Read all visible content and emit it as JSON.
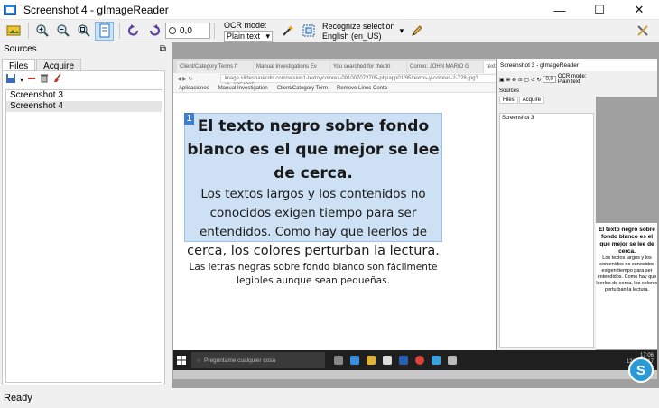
{
  "window": {
    "title": "Screenshot 4 - gImageReader",
    "minimize": "—",
    "maximize": "☐",
    "close": "✕"
  },
  "toolbar": {
    "resolution_value": "0,0",
    "ocr_mode_label": "OCR mode:",
    "ocr_mode_value": "Plain text",
    "recognize_label": "Recognize selection",
    "recognize_lang": "English (en_US)"
  },
  "sources": {
    "title": "Sources",
    "tabs": [
      "Files",
      "Acquire"
    ],
    "files": [
      "Screenshot 3",
      "Screenshot 4"
    ],
    "selected_index": 1
  },
  "browser": {
    "tabs": [
      "Client/Category Terms fr",
      "Manual Investigations Ev",
      "You searched for theutri",
      "Correo: JOHN MARIO G",
      "texto"
    ],
    "address": "image.slidesharecdn.com/sesion1-textoycolores-091007072705-phpapp01/95/textos-y-colores-2-728.jpg?cb=1254905",
    "bookmarks": [
      "Aplicaciones",
      "Manual Investigation",
      "Client/Category Term",
      "Remove Lines Conta"
    ]
  },
  "document": {
    "selection_number": "1",
    "heading": "El texto negro sobre fondo blanco es el que mejor se lee de cerca.",
    "para1": "Los textos largos y los contenidos no conocidos exigen tiempo para ser entendidos. Como hay que leerlos de",
    "para2": "cerca, los colores perturban la lectura.",
    "para3": "Las letras negras sobre fondo blanco son fácilmente legibles aunque sean pequeñas."
  },
  "inner_window": {
    "title": "Screenshot 3 - gImageReader",
    "res": "0,0",
    "ocr_label": "OCR mode:",
    "ocr_value": "Plain text",
    "sources": "Sources",
    "tab_files": "Files",
    "tab_acquire": "Acquire",
    "file": "Screenshot 3",
    "page_heading": "El texto negro sobre fondo blanco es el que mejor se lee de cerca.",
    "page_body": "Los textos largos y los contenidos no conocidos exigen tiempo para ser entendidos. Como hay que leerlos de cerca, los colores perturban la lectura."
  },
  "taskbar": {
    "search_placeholder": "Pregúntame cualquier cosa",
    "time": "17:06",
    "date": "12/01/2017"
  },
  "status": {
    "text": "Ready"
  },
  "colors": {
    "selection_fill": "#cde0f4",
    "selection_badge": "#3c7ed0",
    "taskbar": "#1f1f1f"
  }
}
